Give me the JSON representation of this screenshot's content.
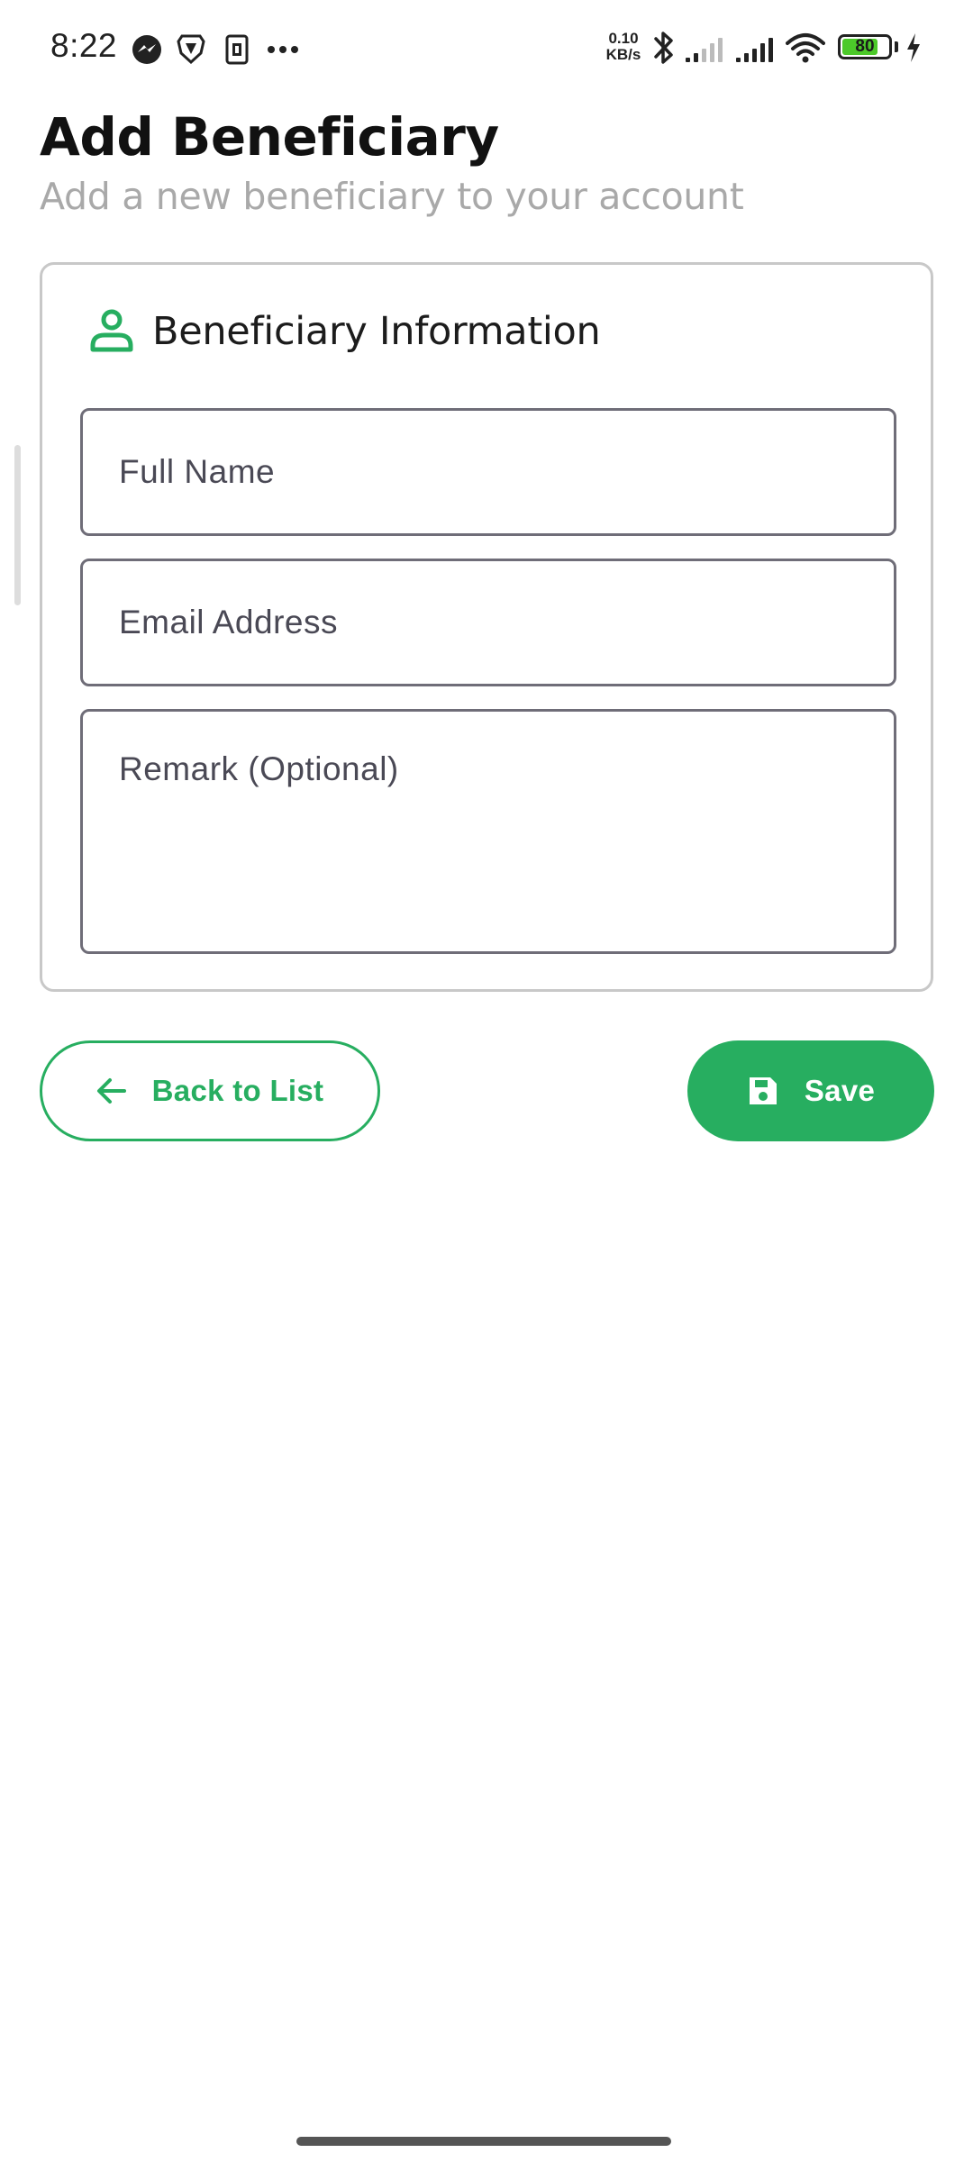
{
  "status_bar": {
    "time": "8:22",
    "network_speed_value": "0.10",
    "network_speed_unit": "KB/s",
    "battery_level": "80",
    "battery_fraction": 0.8,
    "notification_icons": [
      "messenger-icon",
      "brave-browser-icon",
      "sim-card-icon",
      "more-notifications-icon"
    ],
    "system_icons": [
      "bluetooth-icon",
      "signal-weak-icon",
      "signal-full-icon",
      "wifi-icon",
      "battery-icon",
      "charging-icon"
    ]
  },
  "header": {
    "title": "Add Beneficiary",
    "subtitle": "Add a new beneficiary to your account"
  },
  "card": {
    "icon": "person-icon",
    "title": "Beneficiary Information",
    "fields": {
      "full_name": {
        "placeholder": "Full Name",
        "value": ""
      },
      "email": {
        "placeholder": "Email Address",
        "value": ""
      },
      "remark": {
        "placeholder": "Remark (Optional)",
        "value": ""
      }
    }
  },
  "actions": {
    "back_label": "Back to List",
    "back_icon": "arrow-left-icon",
    "save_label": "Save",
    "save_icon": "save-icon"
  },
  "colors": {
    "accent": "#27ae60",
    "text_primary": "#111111",
    "text_muted": "#a9a9a9",
    "field_border": "#6f6d78",
    "card_border": "#c8c8c8",
    "battery_fill": "#4cc92a"
  }
}
